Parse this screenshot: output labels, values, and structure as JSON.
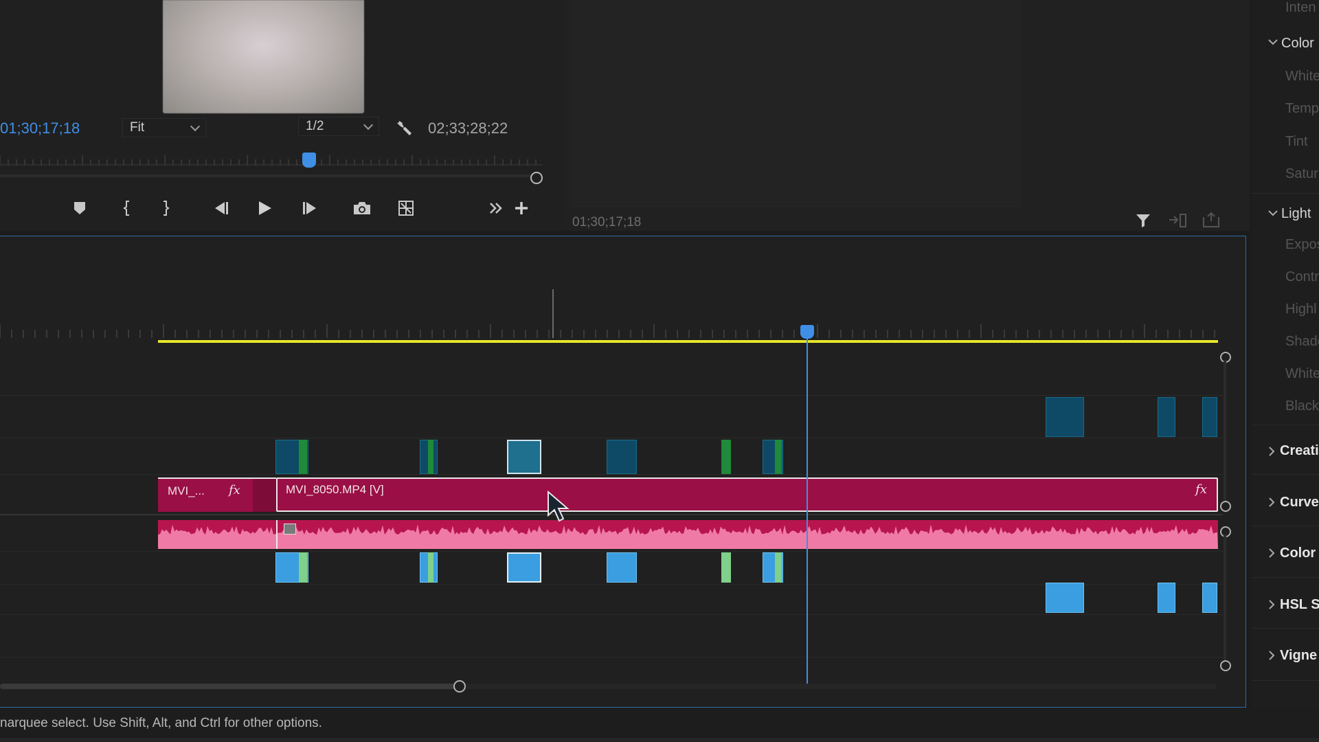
{
  "source_monitor": {
    "current_timecode": "01;30;17;18",
    "zoom": "Fit",
    "resolution": "1/2",
    "duration": "02;33;28;22"
  },
  "program_monitor": {
    "timecode": "01;30;17;18"
  },
  "timeline": {
    "v_clip_short_label": "MVI_...",
    "v_clip_label": "MVI_8050.MP4 [V]",
    "fx_label": "fx"
  },
  "lumetri": {
    "items": [
      {
        "label": "Inten",
        "kind": "sub"
      },
      {
        "label": "Color",
        "kind": "head"
      },
      {
        "label": "White",
        "kind": "sub"
      },
      {
        "label": "Temp",
        "kind": "sub"
      },
      {
        "label": "Tint",
        "kind": "sub"
      },
      {
        "label": "Satur",
        "kind": "sub"
      },
      {
        "label": "Light",
        "kind": "head"
      },
      {
        "label": "Expos",
        "kind": "sub"
      },
      {
        "label": "Contr",
        "kind": "sub"
      },
      {
        "label": "Highl",
        "kind": "sub"
      },
      {
        "label": "Shado",
        "kind": "sub"
      },
      {
        "label": "White",
        "kind": "sub"
      },
      {
        "label": "Black",
        "kind": "sub"
      },
      {
        "label": "Creati",
        "kind": "section"
      },
      {
        "label": "Curve",
        "kind": "section"
      },
      {
        "label": "Color",
        "kind": "section"
      },
      {
        "label": "HSL S",
        "kind": "section"
      },
      {
        "label": "Vigne",
        "kind": "section"
      }
    ]
  },
  "status_bar": {
    "text": "narquee select. Use Shift, Alt, and Ctrl for other options."
  },
  "colors": {
    "accent_blue": "#3f8fe6",
    "work_area_yellow": "#e6e62a",
    "video_clip_pink": "#9a0f45",
    "audio_clip_pink": "#d63f7c"
  }
}
